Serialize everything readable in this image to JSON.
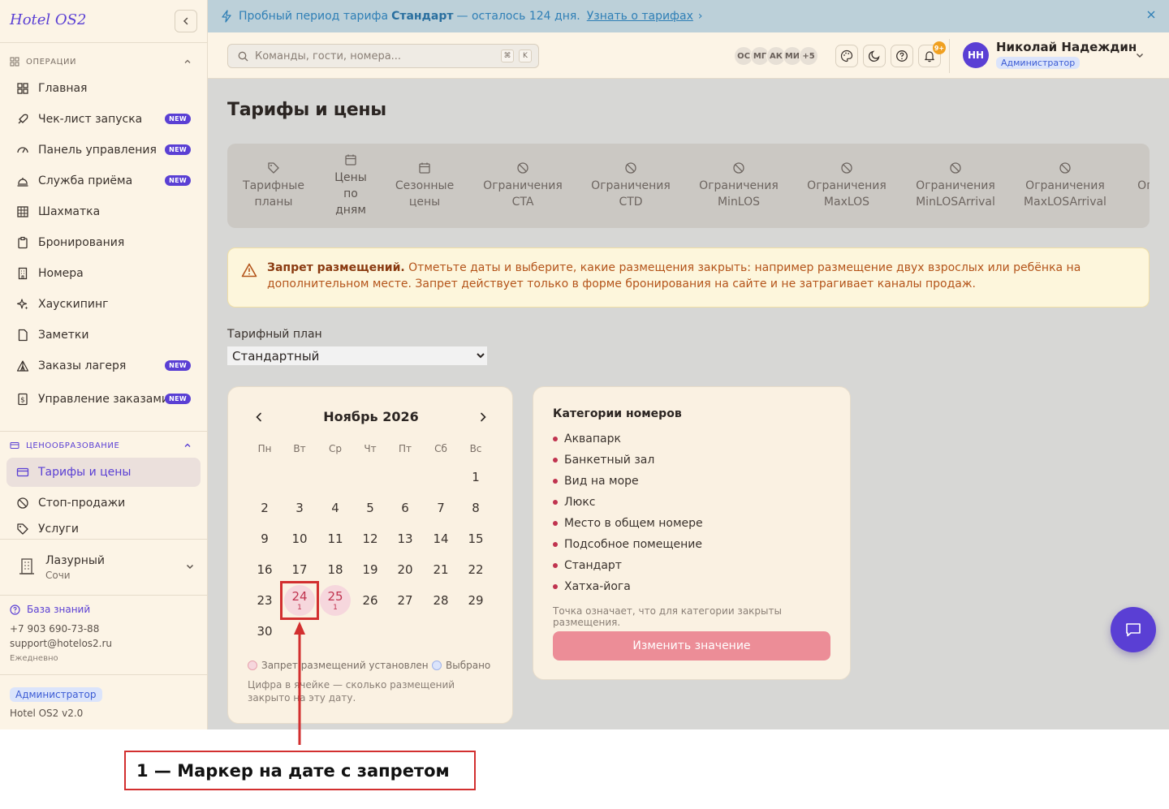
{
  "brand": "Hotel OS2",
  "sidebar": {
    "section_operations": "ОПЕРАЦИИ",
    "section_pricing": "ЦЕНООБРАЗОВАНИЕ",
    "new_badge": "NEW",
    "items": [
      {
        "label": "Главная",
        "icon": "dashboard-icon",
        "new": false
      },
      {
        "label": "Чек-лист запуска",
        "icon": "rocket-icon",
        "new": true
      },
      {
        "label": "Панель управления",
        "icon": "gauge-icon",
        "new": true
      },
      {
        "label": "Служба приёма",
        "icon": "bell-service-icon",
        "new": true
      },
      {
        "label": "Шахматка",
        "icon": "grid-icon",
        "new": false
      },
      {
        "label": "Бронирования",
        "icon": "clipboard-icon",
        "new": false
      },
      {
        "label": "Номера",
        "icon": "building-icon",
        "new": false
      },
      {
        "label": "Хаускипинг",
        "icon": "sparkles-icon",
        "new": false
      },
      {
        "label": "Заметки",
        "icon": "note-icon",
        "new": false
      },
      {
        "label": "Заказы лагеря",
        "icon": "tent-icon",
        "new": true
      },
      {
        "label": "Управление заказами",
        "icon": "receipt-icon",
        "new": true
      }
    ],
    "pricing_items": [
      {
        "label": "Тарифы и цены",
        "icon": "credit-card-icon",
        "active": true
      },
      {
        "label": "Стоп-продажи",
        "icon": "ban-icon",
        "active": false
      },
      {
        "label": "Услуги",
        "icon": "tag-icon",
        "active": false
      }
    ],
    "hotel": {
      "name": "Лазурный",
      "city": "Сочи"
    },
    "knowledge_base": "База знаний",
    "phone": "+7 903 690-73-88",
    "email": "support@hotelos2.ru",
    "schedule": "Ежедневно",
    "role": "Администратор",
    "version": "Hotel OS2 v2.0"
  },
  "banner": {
    "prefix": "Пробный период тарифа",
    "plan": "Стандарт",
    "suffix": "— осталось 124 дня.",
    "link": "Узнать о тарифах",
    "link_arrow": "›"
  },
  "header": {
    "search_placeholder": "Команды, гости, номера...",
    "kbd_cmd": "⌘",
    "kbd_k": "K",
    "avatars": [
      "ОС",
      "МГ",
      "АК",
      "МИ",
      "+5"
    ],
    "notif_count": "9+",
    "user_initials": "НН",
    "user_name": "Николай Надеждин",
    "user_role": "Администратор"
  },
  "page": {
    "title": "Тарифы и цены",
    "tabs": [
      {
        "label": "Тарифные планы",
        "icon": "tag-icon"
      },
      {
        "label": "Цены по дням",
        "icon": "calendar-icon"
      },
      {
        "label": "Сезонные цены",
        "icon": "calendar-icon"
      },
      {
        "label": "Ограничения CTA",
        "icon": "ban-icon"
      },
      {
        "label": "Ограничения CTD",
        "icon": "ban-icon"
      },
      {
        "label": "Ограничения MinLOS",
        "icon": "ban-icon"
      },
      {
        "label": "Ограничения MaxLOS",
        "icon": "ban-icon"
      },
      {
        "label": "Ограничения MinLOSArrival",
        "icon": "ban-icon"
      },
      {
        "label": "Ограничения MaxLOSArrival",
        "icon": "ban-icon"
      },
      {
        "label": "Ограничения FullPa",
        "icon": "ban-icon"
      }
    ],
    "alert_title": "Запрет размещений.",
    "alert_text": "Отметьте даты и выберите, какие размещения закрыть: например размещение двух взрослых или ребёнка на дополнительном месте. Запрет действует только в форме бронирования на сайте и не затрагивает каналы продаж.",
    "plan_label": "Тарифный план",
    "plan_value": "Стандартный"
  },
  "calendar": {
    "month": "Ноябрь 2026",
    "weekdays": [
      "Пн",
      "Вт",
      "Ср",
      "Чт",
      "Пт",
      "Сб",
      "Вс"
    ],
    "first_weekday_index": 6,
    "days_in_month": 30,
    "blocked": [
      {
        "day": 24,
        "count": "1"
      },
      {
        "day": 25,
        "count": "1"
      }
    ],
    "legend_blocked": "Запрет размещений установлен",
    "legend_selected": "Выбрано",
    "note": "Цифра в ячейке — сколько размещений закрыто на эту дату."
  },
  "categories": {
    "title": "Категории номеров",
    "items": [
      "Аквапарк",
      "Банкетный зал",
      "Вид на море",
      "Люкс",
      "Место в общем номере",
      "Подсобное помещение",
      "Стандарт",
      "Хатха-йога"
    ],
    "note": "Точка означает, что для категории закрыты размещения.",
    "button": "Изменить значение"
  },
  "annotation": {
    "caption": "1 — Маркер на дате с запретом"
  },
  "colors": {
    "accent": "#5a3fd4",
    "blocked": "#c0334f",
    "annotation": "#d22f2f"
  }
}
